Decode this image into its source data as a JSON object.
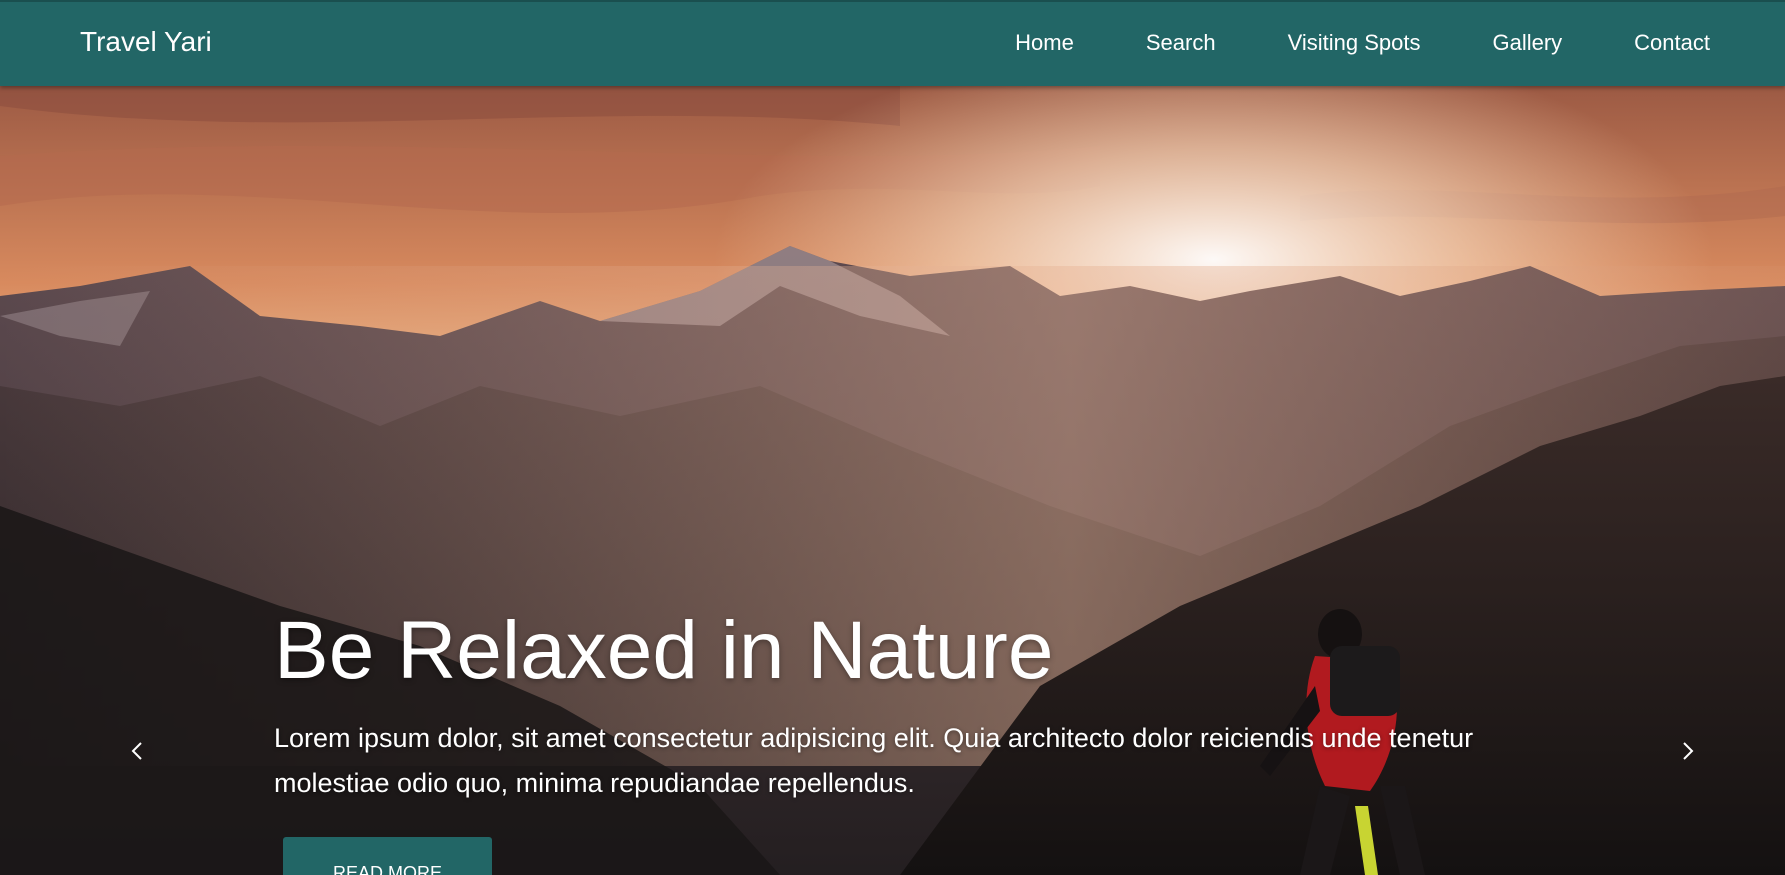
{
  "navbar": {
    "brand": "Travel Yari",
    "links": [
      {
        "label": "Home"
      },
      {
        "label": "Search"
      },
      {
        "label": "Visiting Spots"
      },
      {
        "label": "Gallery"
      },
      {
        "label": "Contact"
      }
    ]
  },
  "hero": {
    "title": "Be Relaxed in Nature",
    "text": "Lorem ipsum dolor, sit amet consectetur adipisicing elit. Quia architecto dolor reiciendis unde tenetur molestiae odio quo, minima repudiandae repellendus.",
    "button_label": "READ MORE",
    "prev_icon": "chevron-left-icon",
    "next_icon": "chevron-right-icon"
  },
  "colors": {
    "navbar_bg": "#226666",
    "accent": "#226666",
    "text": "#ffffff"
  }
}
